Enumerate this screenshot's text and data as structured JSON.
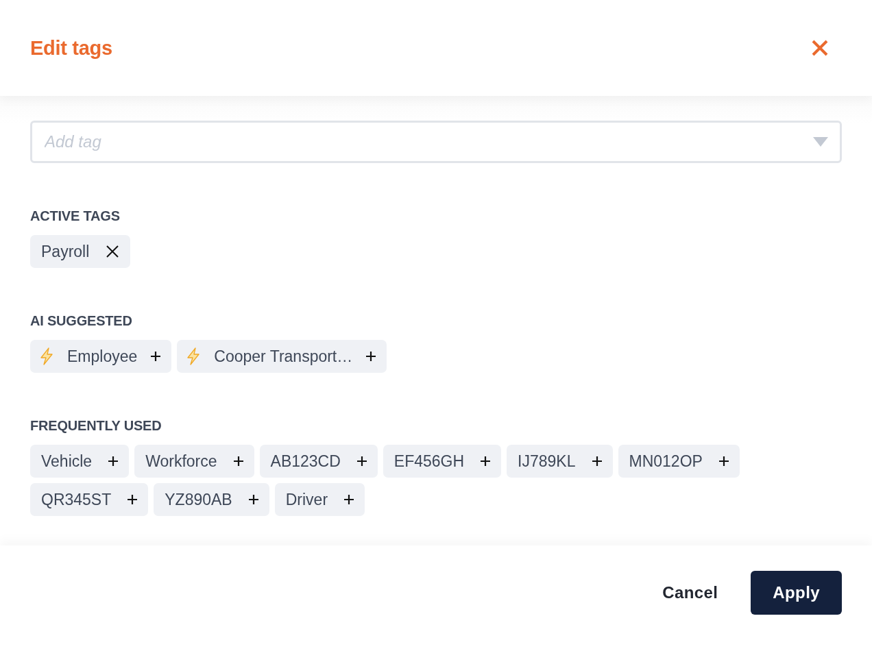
{
  "dialog": {
    "title": "Edit tags"
  },
  "tag_field": {
    "placeholder": "Add tag"
  },
  "sections": [
    {
      "heading": "ACTIVE TAGS",
      "tags": [
        {
          "label": "Payroll",
          "kind": "active"
        }
      ]
    },
    {
      "heading": "AI SUGGESTED",
      "tags": [
        {
          "label": "Employee",
          "kind": "suggested"
        },
        {
          "label": "Cooper Transport…",
          "kind": "suggested"
        }
      ]
    },
    {
      "heading": "FREQUENTLY USED",
      "tags": [
        {
          "label": "Vehicle",
          "kind": "frequent"
        },
        {
          "label": "Workforce",
          "kind": "frequent"
        },
        {
          "label": "AB123CD",
          "kind": "frequent"
        },
        {
          "label": "EF456GH",
          "kind": "frequent"
        },
        {
          "label": "IJ789KL",
          "kind": "frequent"
        },
        {
          "label": "MN012OP",
          "kind": "frequent"
        },
        {
          "label": "QR345ST",
          "kind": "frequent"
        },
        {
          "label": "YZ890AB",
          "kind": "frequent"
        },
        {
          "label": "Driver",
          "kind": "frequent"
        }
      ]
    }
  ],
  "buttons": [
    {
      "label": "Cancel",
      "kind": "secondary"
    },
    {
      "label": "Apply",
      "kind": "primary"
    }
  ]
}
